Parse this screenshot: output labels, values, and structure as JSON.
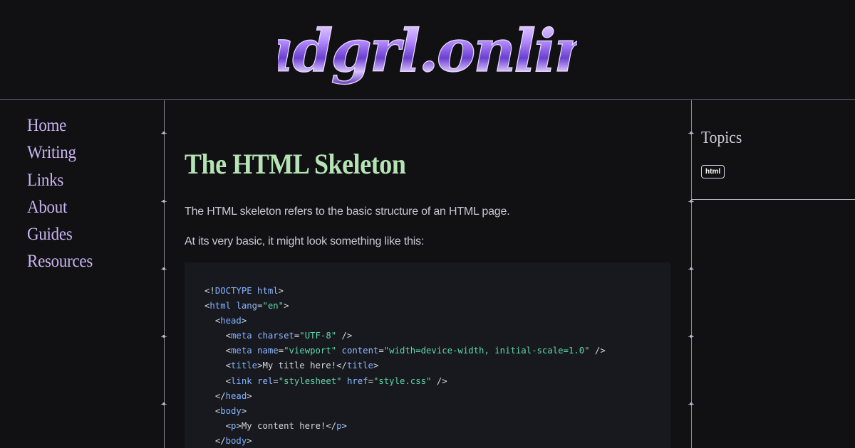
{
  "site": {
    "logo_text": "sadgrl.online"
  },
  "nav": {
    "items": [
      {
        "label": "Home"
      },
      {
        "label": "Writing"
      },
      {
        "label": "Links"
      },
      {
        "label": "About"
      },
      {
        "label": "Guides"
      },
      {
        "label": "Resources"
      }
    ]
  },
  "article": {
    "title": "The HTML Skeleton",
    "paragraph_1": "The HTML skeleton refers to the basic structure of an HTML page.",
    "paragraph_2": "At its very basic, it might look something like this:"
  },
  "sidebar": {
    "heading": "Topics",
    "tags": [
      {
        "label": "html"
      }
    ]
  },
  "colors": {
    "background": "#111113",
    "nav_link": "#c8b4f2",
    "title": "#b6e3b6",
    "code_bg": "#18191f",
    "code_tag": "#7fb3ff",
    "code_string": "#5fd6a8",
    "logo": "#9b6cff"
  }
}
